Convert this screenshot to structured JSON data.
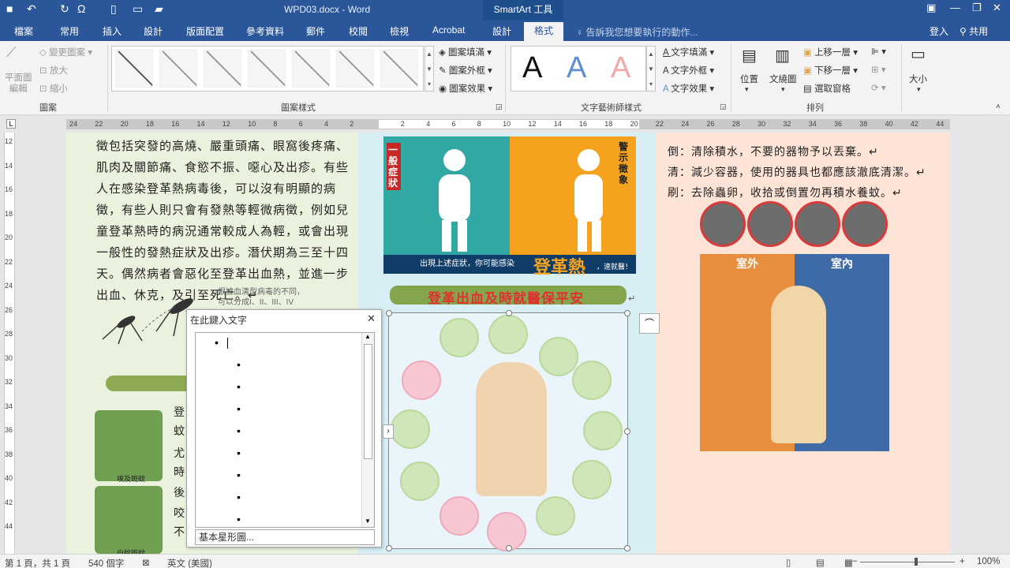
{
  "titlebar": {
    "doc_title": "WPD03.docx - Word",
    "tools_title": "SmartArt 工具",
    "undo_glyph": "↶",
    "omega_glyph": "Ω",
    "min_glyph": "—",
    "restore_glyph": "❐",
    "close_glyph": "✕",
    "ribbon_opt_glyph": "▣"
  },
  "tabs": [
    "檔案",
    "常用",
    "插入",
    "設計",
    "版面配置",
    "參考資料",
    "郵件",
    "校閱",
    "檢視",
    "Acrobat",
    "設計",
    "格式"
  ],
  "tellme": "告訴我您想要執行的動作...",
  "login": "登入",
  "share": "共用",
  "ribbon": {
    "shape_group": {
      "edit": "平面圖\n編輯",
      "change": "變更圖案",
      "larger": "放大",
      "smaller": "縮小",
      "label": "圖案"
    },
    "shape_styles": {
      "fill": "圖案填滿",
      "outline": "圖案外框",
      "effects": "圖案效果",
      "label": "圖案樣式"
    },
    "wordart": {
      "letters": [
        "A",
        "A",
        "A"
      ],
      "fill": "文字填滿",
      "outline": "文字外框",
      "effects": "文字效果",
      "label": "文字藝術師樣式"
    },
    "arrange": {
      "position": "位置",
      "wrap": "文繞圖",
      "forward": "上移一層",
      "backward": "下移一層",
      "pane": "選取窗格",
      "label": "排列"
    },
    "size": {
      "label": "大小"
    }
  },
  "ruler_numbers": [
    "24",
    "22",
    "20",
    "18",
    "16",
    "14",
    "12",
    "10",
    "8",
    "6",
    "4",
    "2",
    "",
    "2",
    "4",
    "6",
    "8",
    "10",
    "12",
    "14",
    "16",
    "18",
    "20",
    "22",
    "24",
    "26",
    "28",
    "30",
    "32",
    "34",
    "36",
    "38",
    "40",
    "42",
    "44"
  ],
  "vruler_numbers": [
    "12",
    "14",
    "16",
    "18",
    "20",
    "22",
    "24",
    "26",
    "28",
    "30",
    "32",
    "34",
    "36",
    "38",
    "40",
    "42",
    "44"
  ],
  "col1_text": "徵包括突發的高燒、嚴重頭痛、眼窩後疼痛、肌肉及關節痛、食慾不振、噁心及出疹。有些人在感染登革熱病毒後，可以沒有明顯的病徵，有些人則只會有發熱等輕微病徵，例如兒童登革熱時的病況通常較成人為輕，或會出現一般性的發熱症狀及出疹。潛伏期為三至十四天。偶然病者會惡化至登革出血熱，並進一步出血、休克，及引至死亡。↵",
  "col1_mosq_text": "根據血清型病毒的不同，\n可以分成I、II、III、IV",
  "col1_clipped": [
    "登",
    "蚊",
    "尤",
    "時",
    "後",
    "咬",
    "不"
  ],
  "col1_captions": [
    "埃及斑蚊",
    "白紋斑蚊"
  ],
  "col2": {
    "sym_left_title": "一般症狀",
    "sym_right_title": "警示徵象",
    "sym_band": "出現上述症狀，你可能感染",
    "sym_big": "登革熱",
    "sym_tail": "，速就醫！",
    "banner": "登革出血及時就醫保平安",
    "smartart_return": "↵"
  },
  "col3_lines": [
    "倒：清除積水，不要的器物予以丟棄。↵",
    "清：減少容器，使用的器具也都應該澈底清潔。↵",
    "刷：去除蟲卵，收拾或倒置勿再積水養蚊。↵"
  ],
  "col3_inout": [
    "室外",
    "室內"
  ],
  "textpane": {
    "title": "在此鍵入文字",
    "close": "✕",
    "bullet_count": 9,
    "footer": "基本星形圖..."
  },
  "status": {
    "page": "第 1 頁，共 1 頁",
    "words": "540 個字",
    "lang": "英文 (美國)",
    "zoom": "100%",
    "zoom_minus": "−",
    "zoom_plus": "+"
  }
}
